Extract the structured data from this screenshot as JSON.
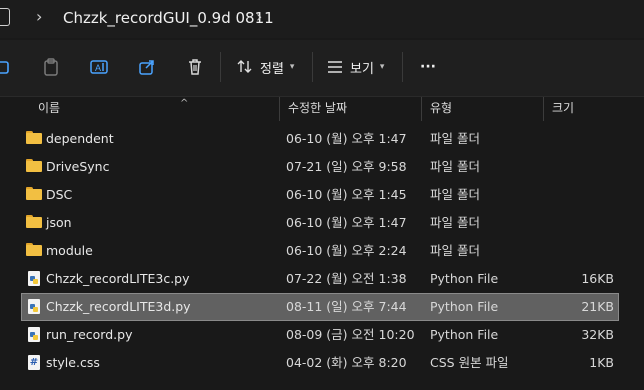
{
  "address": {
    "breadcrumb": "Chzzk_recordGUI_0.9d 0811"
  },
  "toolbar": {
    "sort_label": "정렬",
    "view_label": "보기",
    "more_label": "···"
  },
  "columns": {
    "name": "이름",
    "date": "수정한 날짜",
    "type": "유형",
    "size": "크기"
  },
  "files": [
    {
      "name": "dependent",
      "date": "06-10 (월) 오후 1:47",
      "type": "파일 폴더",
      "size": "",
      "icon": "folder-icon"
    },
    {
      "name": "DriveSync",
      "date": "07-21 (일) 오후 9:58",
      "type": "파일 폴더",
      "size": "",
      "icon": "folder-icon"
    },
    {
      "name": "DSC",
      "date": "06-10 (월) 오후 1:45",
      "type": "파일 폴더",
      "size": "",
      "icon": "folder-icon"
    },
    {
      "name": "json",
      "date": "06-10 (월) 오후 1:47",
      "type": "파일 폴더",
      "size": "",
      "icon": "folder-icon"
    },
    {
      "name": "module",
      "date": "06-10 (월) 오후 2:24",
      "type": "파일 폴더",
      "size": "",
      "icon": "folder-icon"
    },
    {
      "name": "Chzzk_recordLITE3c.py",
      "date": "07-22 (월) 오전 1:38",
      "type": "Python File",
      "size": "16KB",
      "icon": "python-file-icon"
    },
    {
      "name": "Chzzk_recordLITE3d.py",
      "date": "08-11 (일) 오후 7:44",
      "type": "Python File",
      "size": "21KB",
      "icon": "python-file-icon",
      "selected": true
    },
    {
      "name": "run_record.py",
      "date": "08-09 (금) 오전 10:20",
      "type": "Python File",
      "size": "32KB",
      "icon": "python-file-icon"
    },
    {
      "name": "style.css",
      "date": "04-02 (화) 오후 8:20",
      "type": "CSS 원본 파일",
      "size": "1KB",
      "icon": "css-file-icon"
    }
  ]
}
